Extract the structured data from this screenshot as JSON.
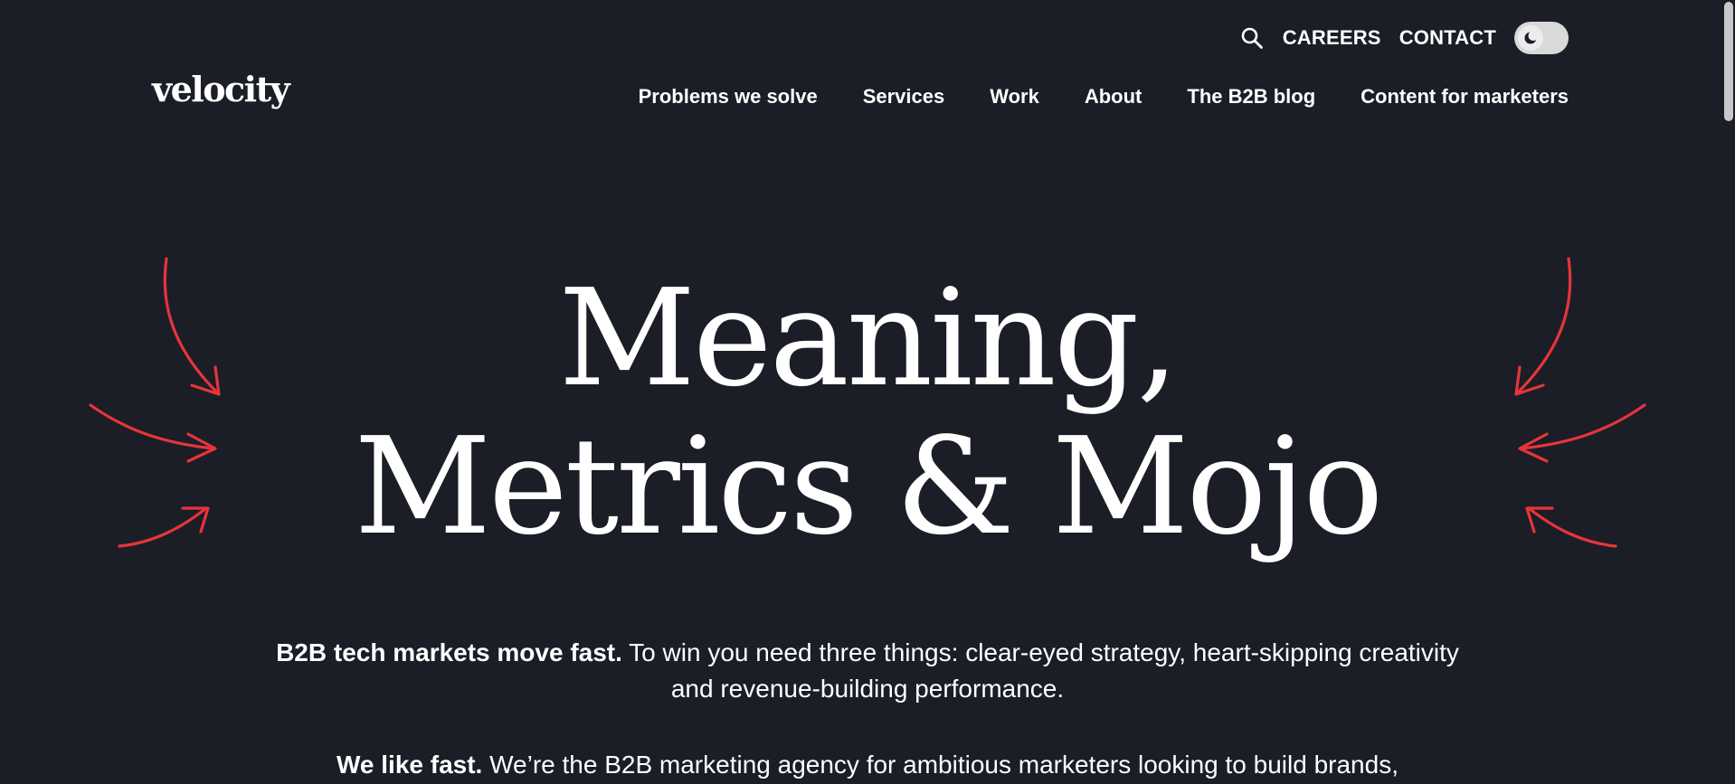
{
  "header": {
    "logo": "velocity",
    "utility": {
      "search_icon": "search-icon",
      "careers_label": "CAREERS",
      "contact_label": "CONTACT",
      "theme_toggle_icon": "moon-icon"
    },
    "nav": [
      {
        "label": "Problems we solve"
      },
      {
        "label": "Services"
      },
      {
        "label": "Work"
      },
      {
        "label": "About"
      },
      {
        "label": "The B2B blog"
      },
      {
        "label": "Content for marketers"
      }
    ]
  },
  "hero": {
    "title_line1": "Meaning,",
    "title_line2": "Metrics & Mojo",
    "arrows_icon": "hand-drawn-arrows-icon"
  },
  "body": {
    "p1_bold": "B2B tech markets move fast.",
    "p1_rest": " To win you need three things: clear-eyed strategy, heart-skipping creativity and revenue-building performance.",
    "p2_bold": "We like fast.",
    "p2_rest": " We’re the B2B marketing agency for ambitious marketers looking to build brands,"
  },
  "colors": {
    "background": "#1b1d27",
    "text": "#ffffff",
    "accent_arrows": "#e6353a",
    "toggle": "#d9d9d9"
  }
}
